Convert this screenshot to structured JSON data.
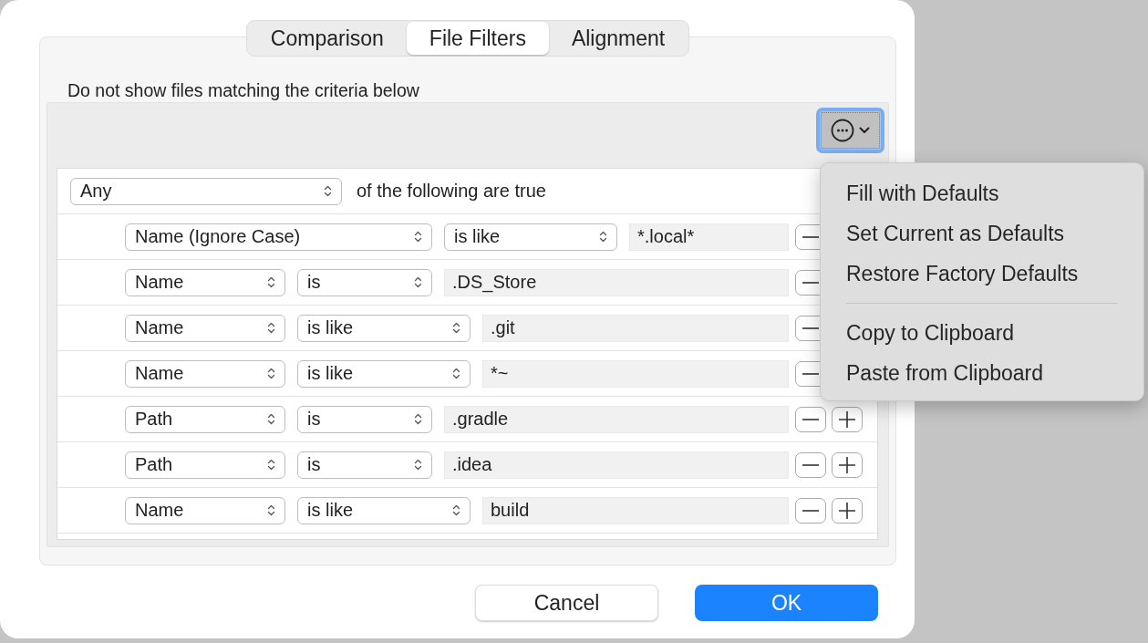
{
  "tabs": [
    {
      "label": "Comparison",
      "selected": false
    },
    {
      "label": "File Filters",
      "selected": true
    },
    {
      "label": "Alignment",
      "selected": false
    }
  ],
  "filters": {
    "description": "Do not show files matching the criteria below",
    "action_button": {
      "focused": true
    },
    "match": {
      "quantifier": "Any",
      "suffix": "of the following are true"
    },
    "rules": [
      {
        "attribute": "Name (Ignore Case)",
        "operator": "is like",
        "value": "*.local*"
      },
      {
        "attribute": "Name",
        "operator": "is",
        "value": ".DS_Store"
      },
      {
        "attribute": "Name",
        "operator": "is like",
        "value": ".git"
      },
      {
        "attribute": "Name",
        "operator": "is like",
        "value": "*~"
      },
      {
        "attribute": "Path",
        "operator": "is",
        "value": ".gradle"
      },
      {
        "attribute": "Path",
        "operator": "is",
        "value": ".idea"
      },
      {
        "attribute": "Name",
        "operator": "is like",
        "value": "build"
      }
    ]
  },
  "menu": {
    "groups": [
      [
        "Fill with Defaults",
        "Set Current as Defaults",
        "Restore Factory Defaults"
      ],
      [
        "Copy to Clipboard",
        "Paste from Clipboard"
      ]
    ]
  },
  "buttons": [
    {
      "label": "Cancel",
      "kind": "secondary"
    },
    {
      "label": "OK",
      "kind": "default"
    }
  ]
}
